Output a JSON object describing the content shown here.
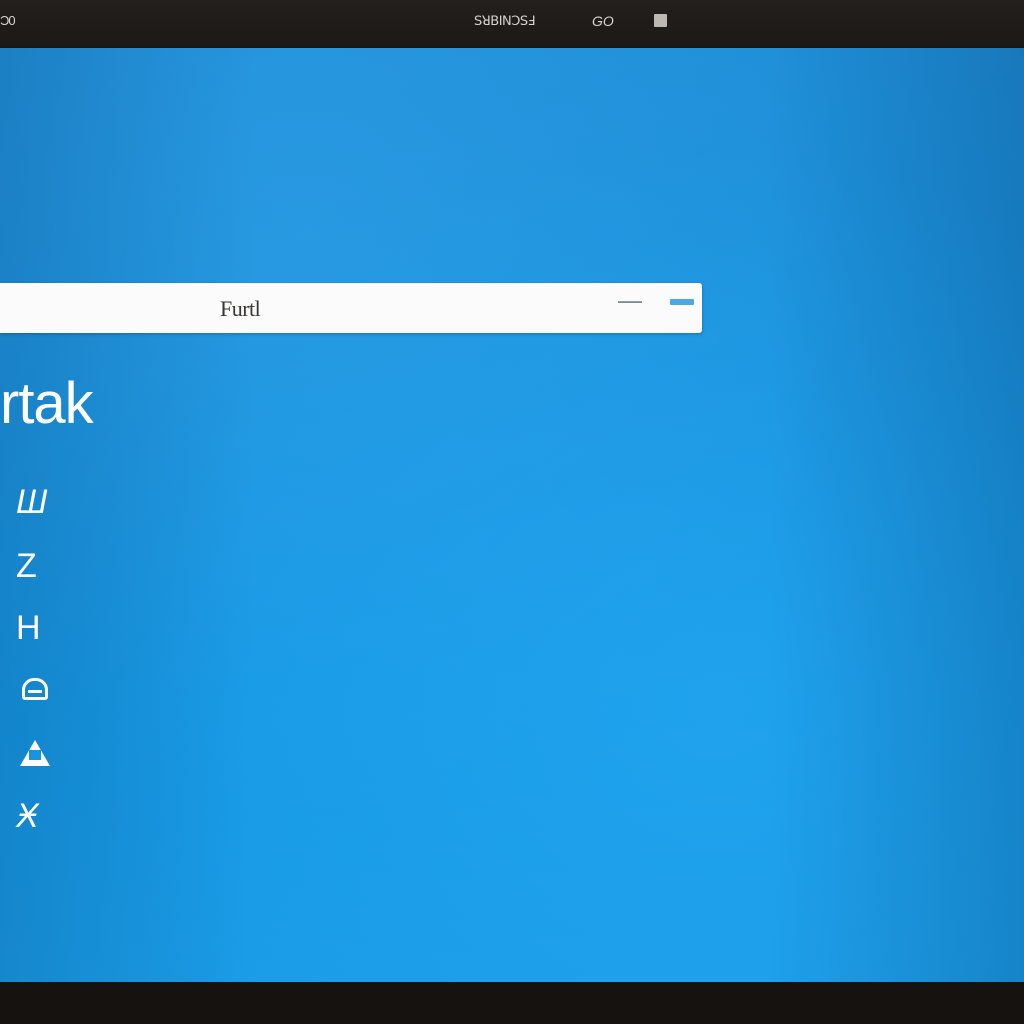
{
  "topbar": {
    "left_glyph": "Ɔ0",
    "title": "ꓢꓤꓐꓲꓠꓛꓢꓞ",
    "mid_glyph": "GO"
  },
  "search": {
    "text": "Furtl"
  },
  "desktop": {
    "big_word": "rtak",
    "side_icons": [
      {
        "glyph": "Ш",
        "icon": "scribble-icon"
      },
      {
        "glyph": "Z",
        "icon": "z-icon"
      },
      {
        "glyph": "H",
        "icon": "h-icon"
      },
      {
        "glyph": "",
        "icon": "lock-icon"
      },
      {
        "glyph": "",
        "icon": "a-icon"
      },
      {
        "glyph": "Ӿ",
        "icon": "x-icon"
      }
    ]
  },
  "colors": {
    "desktop_blue": "#1a94df",
    "topbar": "#1e1b19",
    "search_bg": "#fbfbfb",
    "accent": "#4aa8e2"
  }
}
